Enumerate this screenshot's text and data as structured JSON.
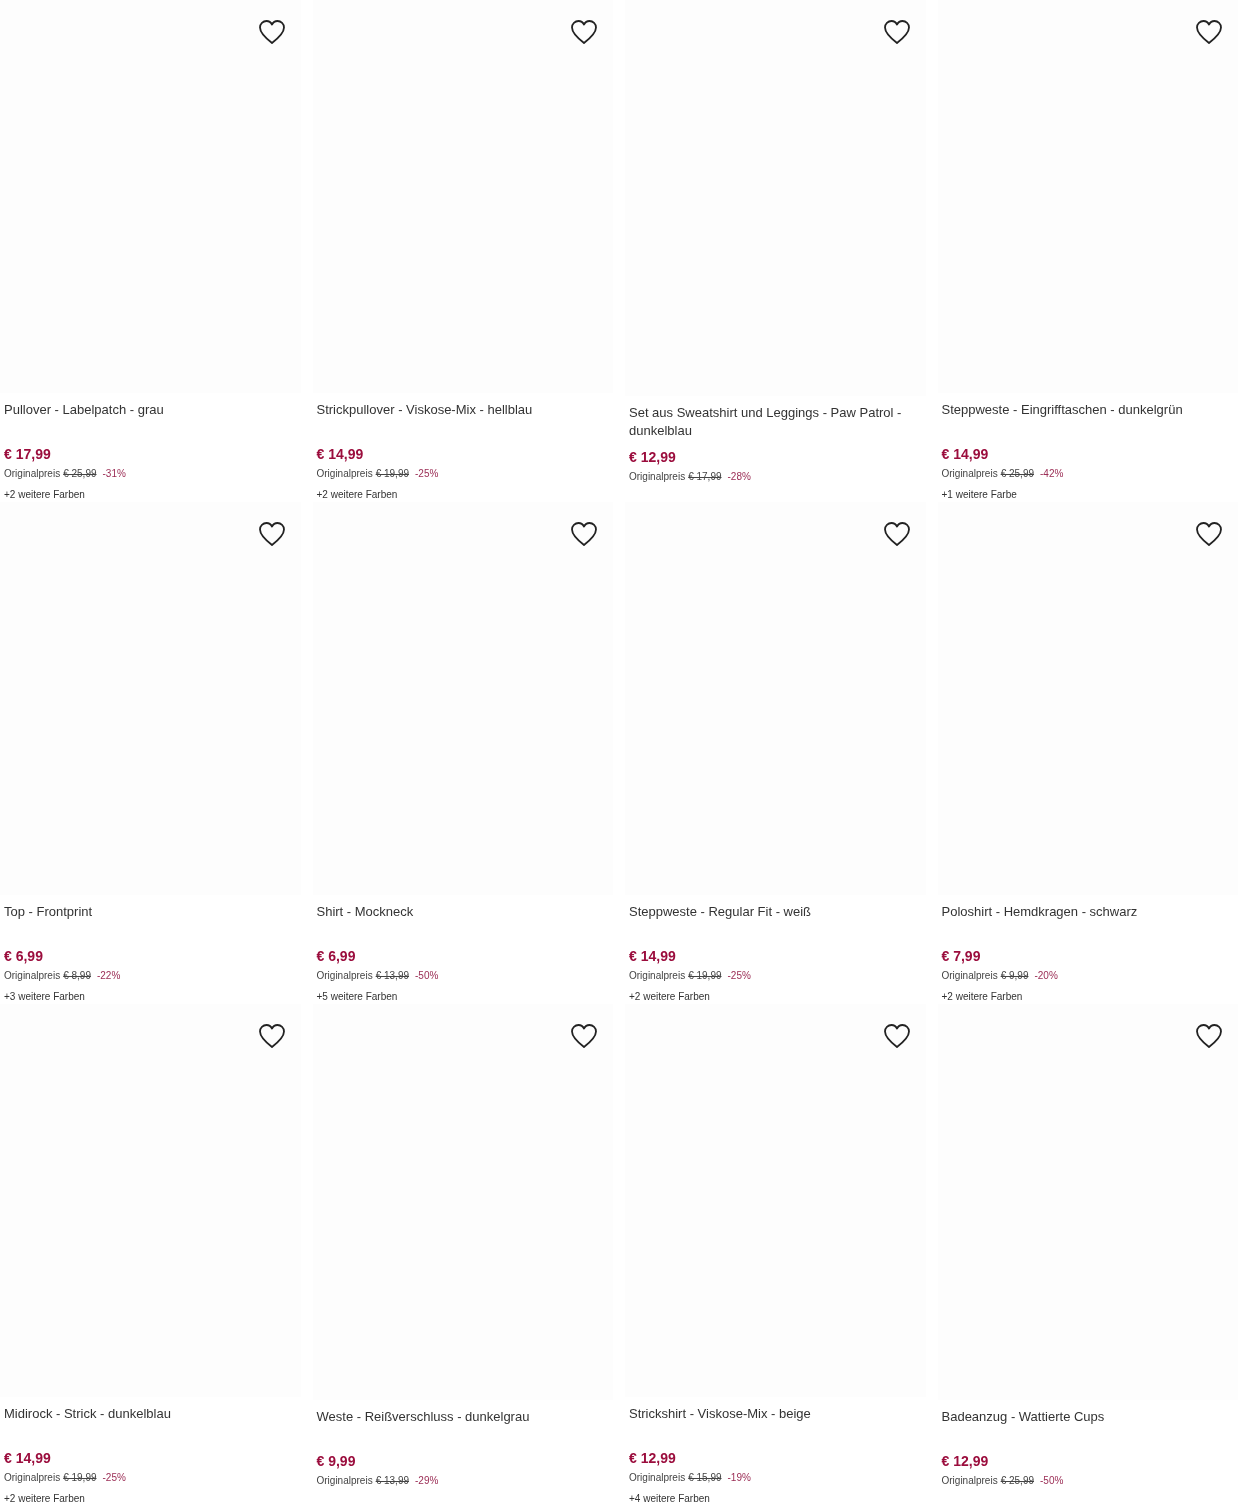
{
  "products": [
    {
      "title": "Pullover - Labelpatch - grau",
      "price": "€ 17,99",
      "original_label": "Originalpreis",
      "original_price": "€ 25,99",
      "discount": "-31%",
      "colors": "+2 weitere Farben"
    },
    {
      "title": "Strickpullover - Viskose-Mix - hellblau",
      "price": "€ 14,99",
      "original_label": "Originalpreis",
      "original_price": "€ 19,99",
      "discount": "-25%",
      "colors": "+2 weitere Farben"
    },
    {
      "title": "Set aus Sweatshirt und Leggings - Paw Patrol - dunkelblau",
      "price": "€ 12,99",
      "original_label": "Originalpreis",
      "original_price": "€ 17,99",
      "discount": "-28%"
    },
    {
      "title": "Steppweste - Eingrifftaschen - dunkelgrün",
      "price": "€ 14,99",
      "original_label": "Originalpreis",
      "original_price": "€ 25,99",
      "discount": "-42%",
      "colors": "+1 weitere Farbe"
    },
    {
      "title": "Top - Frontprint",
      "price": "€ 6,99",
      "original_label": "Originalpreis",
      "original_price": "€ 8,99",
      "discount": "-22%",
      "colors": "+3 weitere Farben"
    },
    {
      "title": "Shirt - Mockneck",
      "price": "€ 6,99",
      "original_label": "Originalpreis",
      "original_price": "€ 13,99",
      "discount": "-50%",
      "colors": "+5 weitere Farben"
    },
    {
      "title": "Steppweste - Regular Fit - weiß",
      "price": "€ 14,99",
      "original_label": "Originalpreis",
      "original_price": "€ 19,99",
      "discount": "-25%",
      "colors": "+2 weitere Farben"
    },
    {
      "title": "Poloshirt - Hemdkragen - schwarz",
      "price": "€ 7,99",
      "original_label": "Originalpreis",
      "original_price": "€ 9,99",
      "discount": "-20%",
      "colors": "+2 weitere Farben"
    },
    {
      "title": "Midirock - Strick - dunkelblau",
      "price": "€ 14,99",
      "original_label": "Originalpreis",
      "original_price": "€ 19,99",
      "discount": "-25%",
      "colors": "+2 weitere Farben"
    },
    {
      "title": "Weste - Reißverschluss - dunkelgrau",
      "price": "€ 9,99",
      "original_label": "Originalpreis",
      "original_price": "€ 13,99",
      "discount": "-29%"
    },
    {
      "title": "Strickshirt - Viskose-Mix - beige",
      "price": "€ 12,99",
      "original_label": "Originalpreis",
      "original_price": "€ 15,99",
      "discount": "-19%",
      "colors": "+4 weitere Farben"
    },
    {
      "title": "Badeanzug - Wattierte Cups",
      "price": "€ 12,99",
      "original_label": "Originalpreis",
      "original_price": "€ 25,99",
      "discount": "-50%"
    }
  ]
}
